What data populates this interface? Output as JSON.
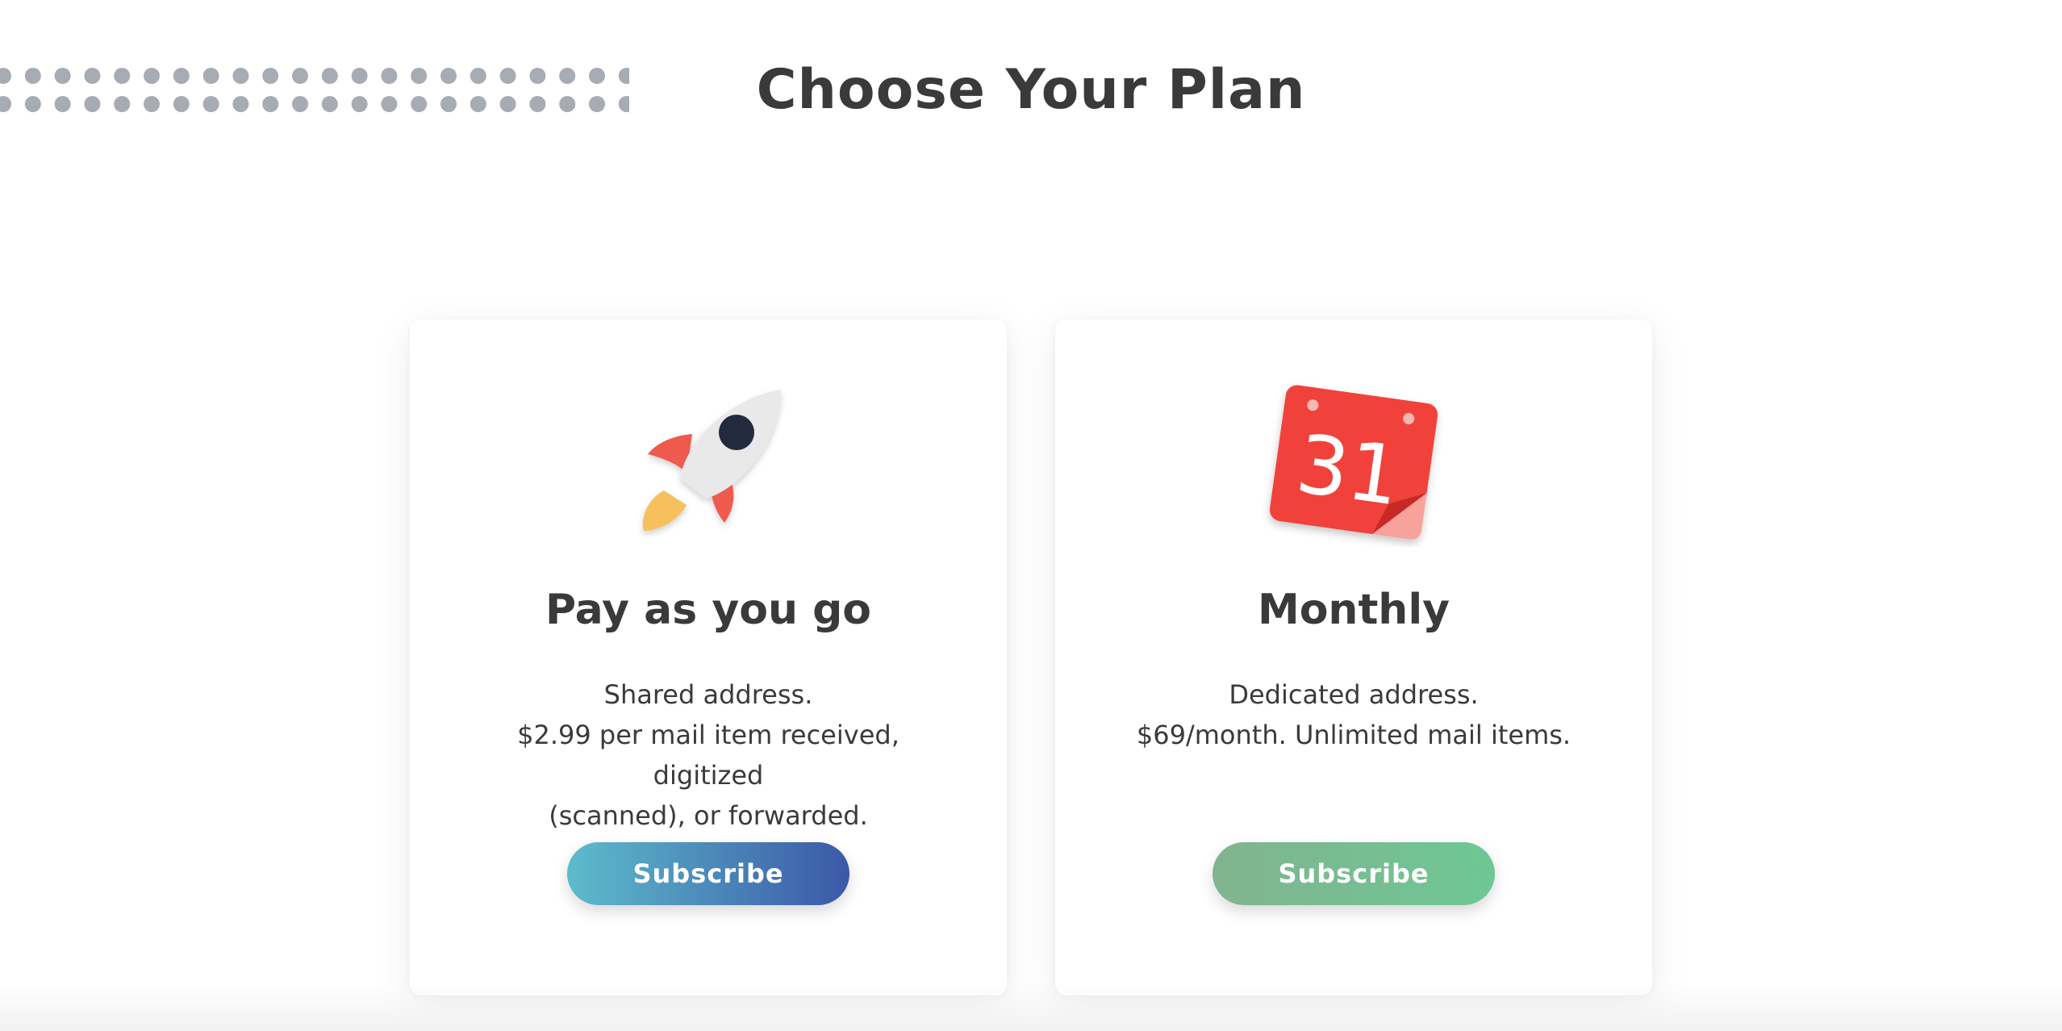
{
  "header": {
    "title": "Choose Your Plan"
  },
  "plans": [
    {
      "icon": "rocket-icon",
      "title": "Pay as you go",
      "description": [
        "Shared address.",
        "$2.99 per mail item received, digitized",
        "(scanned), or forwarded."
      ],
      "button_label": "Subscribe",
      "button_colors": [
        "#5dbccb",
        "#3b58a8"
      ]
    },
    {
      "icon": "calendar-icon",
      "calendar_day": "31",
      "title": "Monthly",
      "description": [
        "Dedicated address.",
        "$69/month. Unlimited mail items."
      ],
      "button_label": "Subscribe",
      "button_colors": [
        "#81b48e",
        "#6ec795"
      ]
    }
  ],
  "colors": {
    "text": "#3a3a3a",
    "dots": "#a7abb3",
    "calendar_red": "#f0433a"
  }
}
